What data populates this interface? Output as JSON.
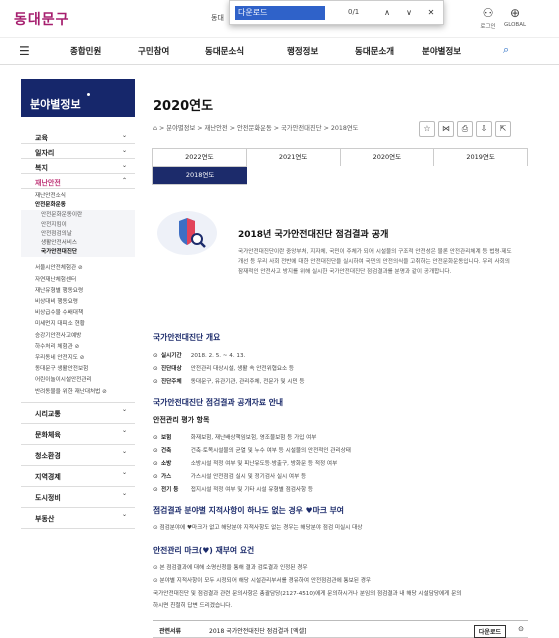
{
  "header": {
    "logo": "동대문구",
    "site_label": "동대",
    "utils": [
      {
        "icon": "person-icon",
        "glyph": "⚇",
        "label": "로그인"
      },
      {
        "icon": "globe-icon",
        "glyph": "⊕",
        "label": "GLOBAL"
      }
    ]
  },
  "find": {
    "query": "다운로드",
    "count": "0/1",
    "prev": "∧",
    "next": "∨",
    "close": "✕"
  },
  "gnb": [
    "종합민원",
    "구민참여",
    "동대문소식",
    "행정정보",
    "동대문소개",
    "분야별정보"
  ],
  "sidebar": {
    "title": "분야별정보",
    "top": [
      {
        "label": "교육"
      },
      {
        "label": "일자리"
      },
      {
        "label": "복지"
      },
      {
        "label": "재난안전"
      }
    ],
    "sub": [
      "재난안전소식",
      "안전문화운동"
    ],
    "sub2": [
      "안전문화운동이란",
      "안전지킴이",
      "안전점검의날",
      "생활안전서비스",
      "국가안전대진단"
    ],
    "more": [
      "서울시안전체험관 ⊘",
      "자연재난체험센터",
      "재난유형별 행동요령",
      "비상대비 행동요령",
      "비상급수물 수배대책",
      "미세먼지 대피소 현황",
      "승강기안전사고예방",
      "하수처리 체험관 ⊘",
      "우리동네 안전지도 ⊘",
      "동대문구 생활안전보험",
      "어린이놀이시설안전관리",
      "반려동물을 위한 재난대처법 ⊘"
    ],
    "lower": [
      "시리교통",
      "문화체육",
      "청소환경",
      "지역경제",
      "도시정비",
      "부동산"
    ]
  },
  "page": {
    "title": "2020연도",
    "breadcrumb": "⌂  >  분야별정보  >  재난안전  >  안전문화운동  >  국가안전대진단  >  2018연도",
    "tools": [
      "☆",
      "⋈",
      "⎙",
      "⇩",
      "⇱"
    ],
    "tabs": [
      "2022연도",
      "2021연도",
      "2020연도",
      "2019연도",
      "2018연도"
    ],
    "intro_title": "2018년 국가안전대진단 점검결과 공개",
    "intro_body": "국가안전대진단이란 중앙부처, 지자체, 국민이 주체가 되어 시설물의 구조적 안전성은 물론 안전관리체계 등 법령·제도 개선 등 우리 사회 전반에 대한 안전대진단을 실시하여 국민의 안전의식을 고취하는 안전문화운동입니다. 우리 사회의 잠재적인 안전사고 방지를 위해 실시한 국가안전대진단 점검결과를 분명과 같이 공개합니다.",
    "sec1": "국가안전대진단 개요",
    "overview": [
      {
        "k": "실시기간",
        "v": "2018. 2. 5. ~ 4. 13."
      },
      {
        "k": "진단대상",
        "v": "안전관리 대상시설, 생활 속 안전위협요소 등"
      },
      {
        "k": "진단주체",
        "v": "동대문구, 유관기관, 관리주체, 전문가 및 시민 등"
      }
    ],
    "sec2": "국가안전대진단 점검결과 공개자료 안내",
    "sub_sec": "안전관리 평가 항목",
    "items": [
      {
        "k": "보험",
        "v": "화재보험, 재난배상책임보험, 영조물보험 등 가입 여부"
      },
      {
        "k": "건축",
        "v": "건축·토목시설물의 균열 및 누수 여부 등 시설물의 안전적인 관리상태"
      },
      {
        "k": "소방",
        "v": "소방시설 적정 여부 및 피난유도등·방출구, 방화문 등 적정 여부"
      },
      {
        "k": "가스",
        "v": "가스시설 안전점검 실시 및 정기검사 실시 여부 등"
      },
      {
        "k": "전기 등",
        "v": "접지시설 적정 여부 및 기타 시설 유형별 점검사항 등"
      }
    ],
    "sec3": "점검결과 분야별 지적사항이 하나도 없는 경우 ♥마크 부여",
    "sec3_note": "⊙ 점검분야에 ♥마크가 없고 해당분야 지적사항도 없는 경우는 해당분야 점검 미실시 대상",
    "sec4": "안전관리 마크(♥) 재부여 요건",
    "req": [
      "⊙ 본 점검결과에 대해 소명신청을 통해 결과 검토결과 인정된 경우",
      "⊙ 분야별 지적사항이 모두 시정되어 해당 시설관리부서를 경유하여 안전점검관에 통보된 경우",
      "국가안전대진단 및 점검결과 관련 문의사항은 총괄담당(2127-4510)에게 문의하시거나 분임의 점검결과 내 해당 시설담당에게 문의",
      "하시면 친절히 답변 드리겠습니다."
    ],
    "footer": {
      "label": "관련서류",
      "file": "2018 국가안전대진단 점검결과 [엑셀]",
      "download": "다운로드",
      "more": "⊙"
    }
  }
}
